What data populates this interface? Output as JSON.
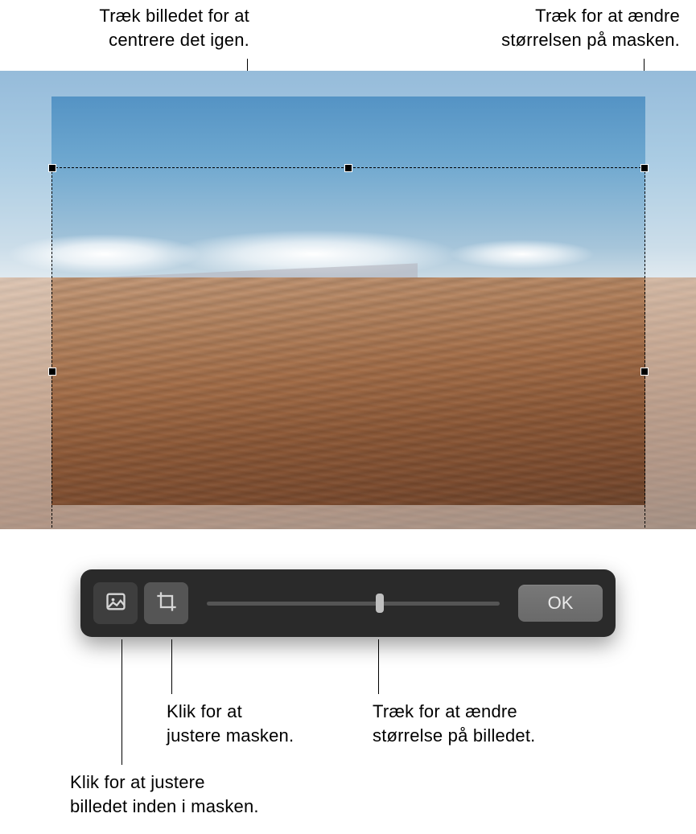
{
  "callouts": {
    "drag_image_recenter": "Træk billedet for at\ncentrere det igen.",
    "drag_resize_mask": "Træk for at ændre\nstørrelsen på masken.",
    "click_adjust_mask": "Klik for at\njustere masken.",
    "drag_resize_image": "Træk for at ændre\nstørrelse på billedet.",
    "click_adjust_image_in_mask": "Klik for at justere\nbilledet inden i masken."
  },
  "toolbar": {
    "image_mode_icon": "image-icon",
    "crop_mode_icon": "crop-icon",
    "ok_button": "OK"
  }
}
